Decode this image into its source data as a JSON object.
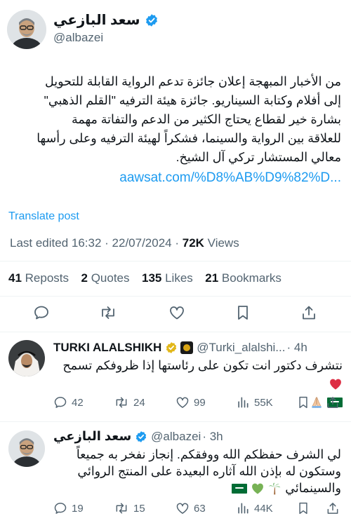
{
  "main_post": {
    "author_name": "سعد البازعي",
    "author_handle": "@albazei",
    "text_lines": [
      "من الأخبار المبهجة إعلان جائزة تدعم الرواية القابلة للتحويل",
      "إلى أفلام وكتابة السيناريو. جائزة هيئة الترفيه \"القلم الذهبي\"",
      "بشارة خير لقطاع يحتاج الكثير من الدعم والتفاتة مهمة",
      "للعلاقة بين الرواية والسينما، فشكراً لهيئة الترفيه وعلى رأسها",
      "معالي المستشار تركي آل الشيخ."
    ],
    "link": "aawsat.com/%D8%AB%D9%82%D...",
    "translate": "Translate post",
    "edited": "Last edited 16:32 · 22/07/2024 · ",
    "views_count": "72K",
    "views_label": " Views",
    "stats": [
      {
        "num": "41",
        "label": "Reposts"
      },
      {
        "num": "2",
        "label": "Quotes"
      },
      {
        "num": "135",
        "label": "Likes"
      },
      {
        "num": "21",
        "label": "Bookmarks"
      }
    ]
  },
  "reply1": {
    "author_name": "TURKI ALALSHIKH",
    "author_handle": "@Turki_alalshi...",
    "time": "· 4h",
    "text_line1": "نتشرف دكتور انت تكون على رئاستها إذا ظروفكم تسمح",
    "counts": {
      "replies": "42",
      "reposts": "24",
      "likes": "99",
      "views": "55K"
    }
  },
  "reply2": {
    "author_name": "سعد البازعي",
    "author_handle": "@albazei",
    "time": "· 3h",
    "text_lines": [
      "لي الشرف حفظكم الله ووفقكم. إنجاز نفخر به جميعاً",
      "وستكون له بإذن الله آثاره البعيدة على المنتج الروائي",
      "والسينمائي"
    ],
    "counts": {
      "replies": "19",
      "reposts": "15",
      "likes": "63",
      "views": "44K"
    }
  },
  "colors": {
    "accent": "#1d9bf0",
    "secondary_text": "#536471",
    "divider": "#eff3f4",
    "verified": "#1d9bf0",
    "heart": "#e0245e"
  }
}
